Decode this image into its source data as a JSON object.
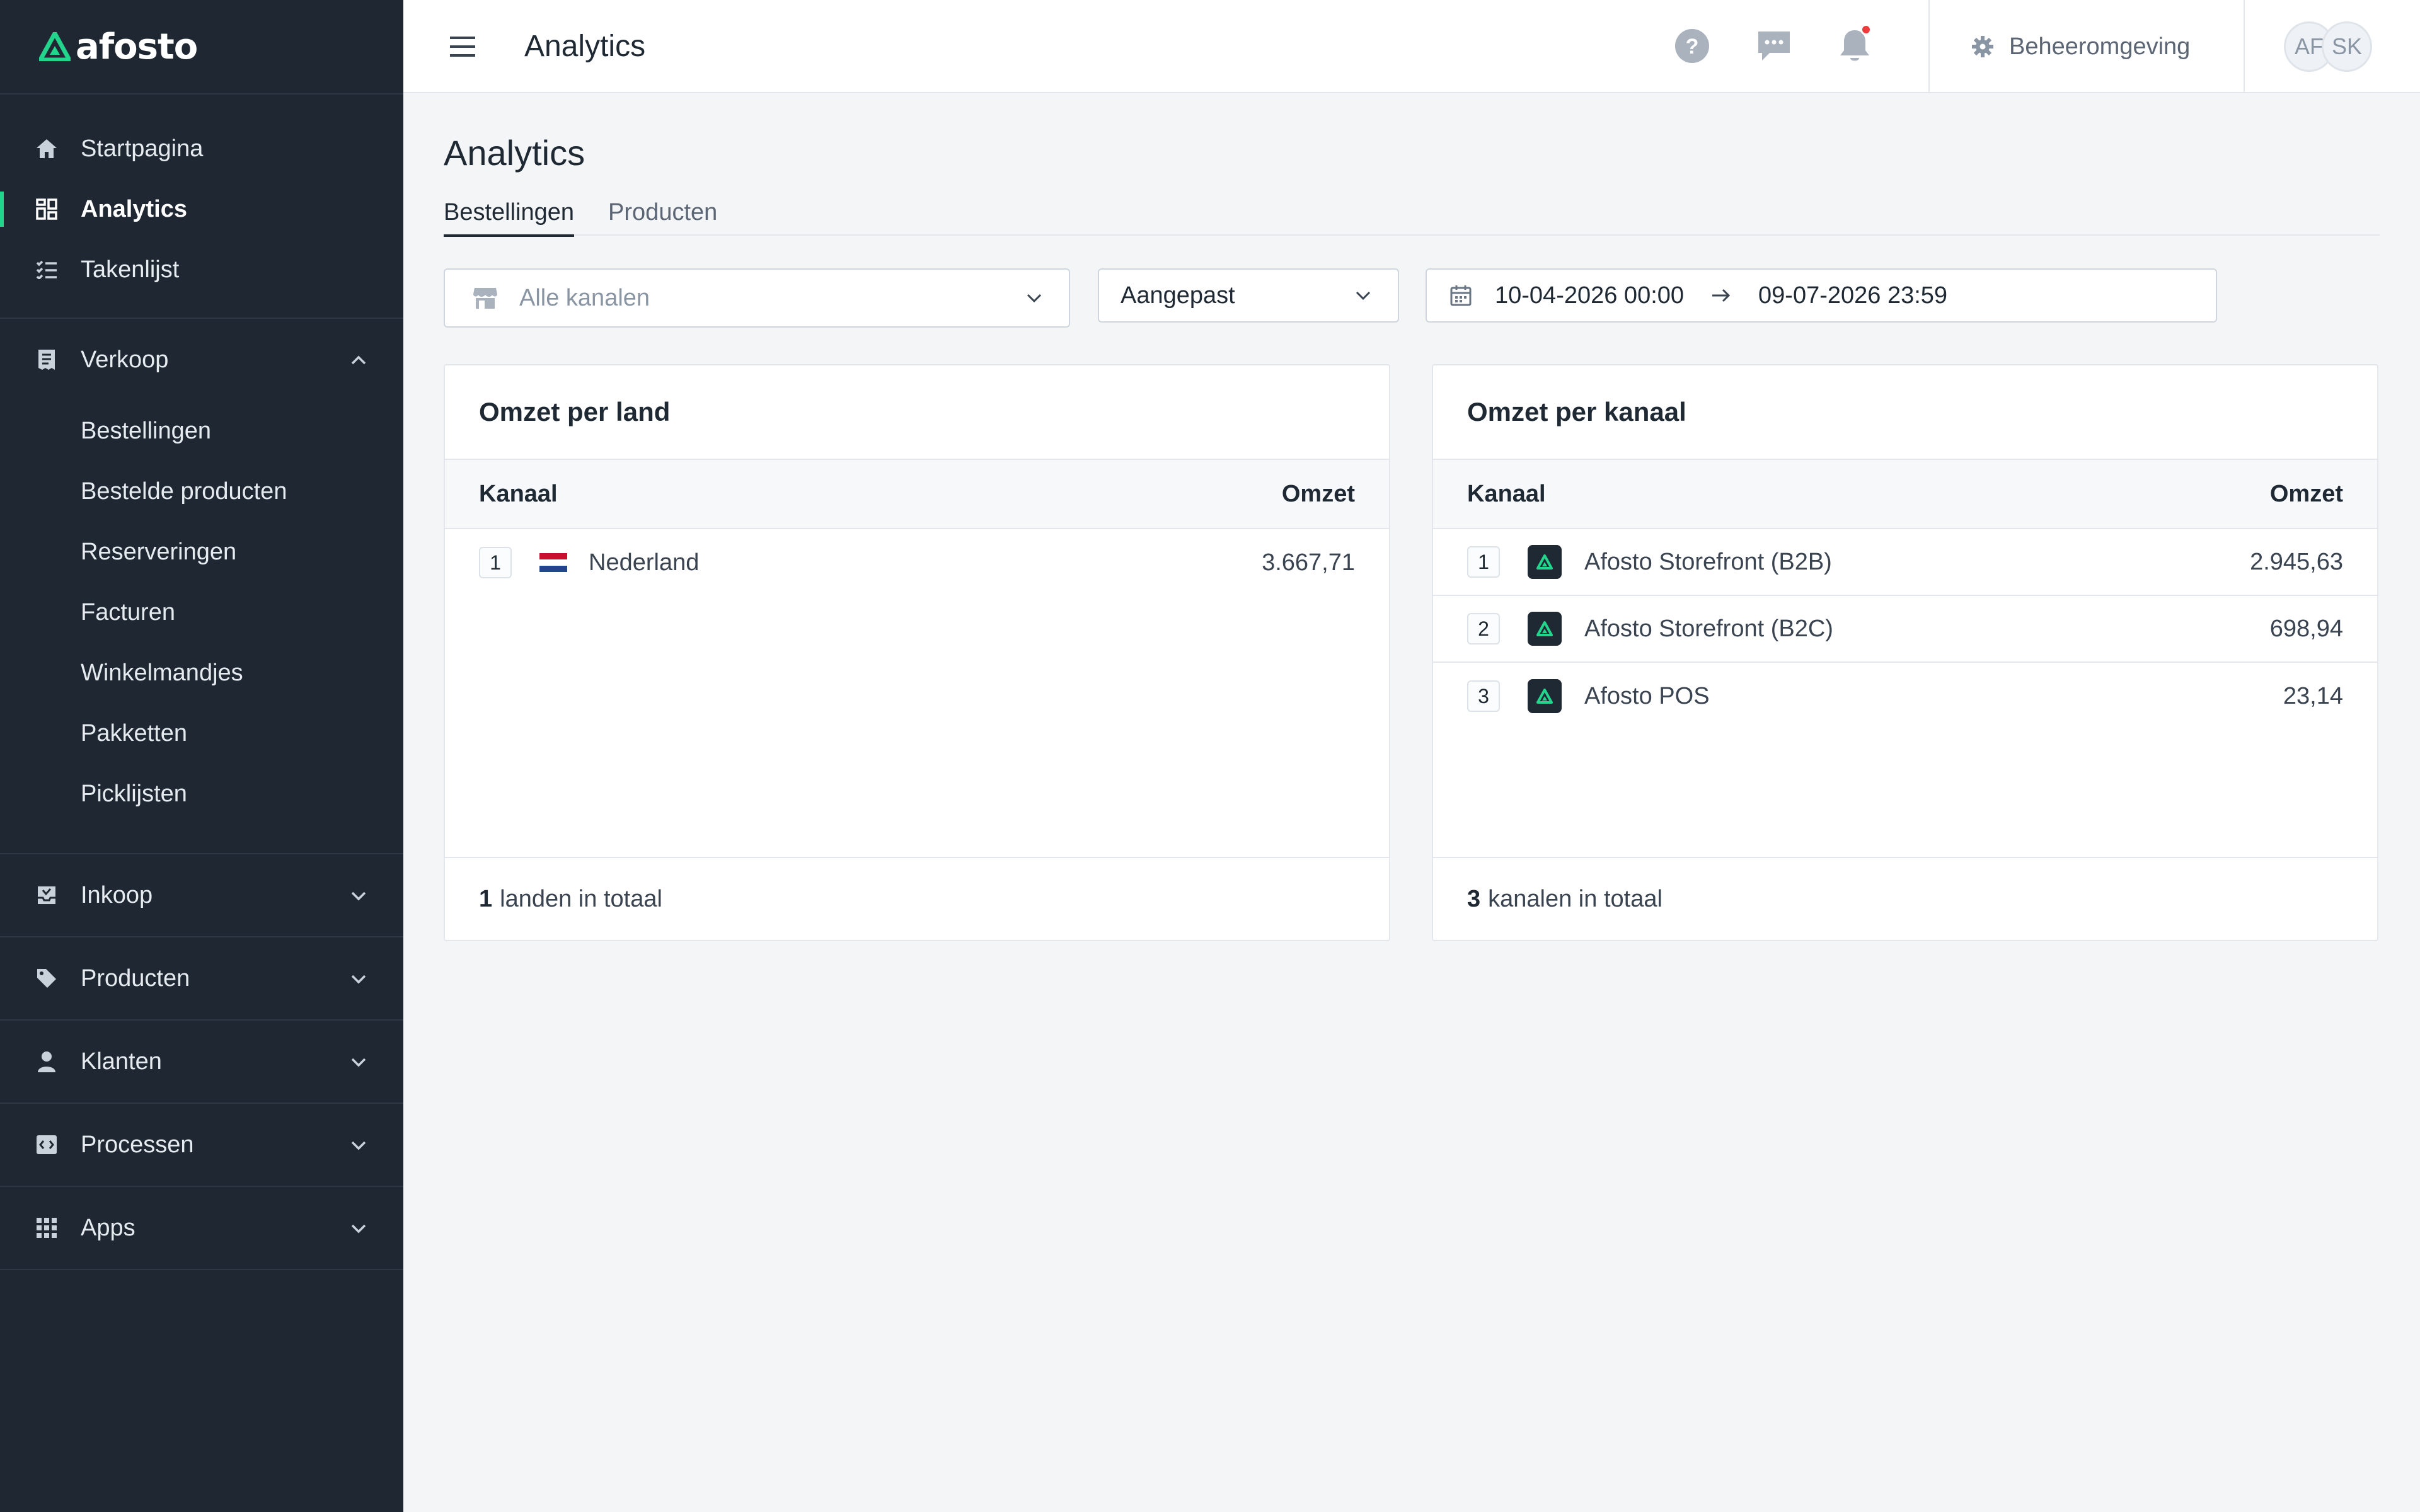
{
  "brand": {
    "name": "afosto",
    "accent": "#22d48c"
  },
  "sidebar": {
    "top_items": [
      {
        "label": "Startpagina",
        "icon": "home-icon"
      },
      {
        "label": "Analytics",
        "icon": "dashboard-icon",
        "active": true
      },
      {
        "label": "Takenlijst",
        "icon": "checklist-icon"
      }
    ],
    "sections": [
      {
        "label": "Verkoop",
        "icon": "receipt-icon",
        "expanded": true,
        "items": [
          "Bestellingen",
          "Bestelde producten",
          "Reserveringen",
          "Facturen",
          "Winkelmandjes",
          "Pakketten",
          "Picklijsten"
        ]
      },
      {
        "label": "Inkoop",
        "icon": "inbox-icon",
        "expanded": false
      },
      {
        "label": "Producten",
        "icon": "tag-icon",
        "expanded": false
      },
      {
        "label": "Klanten",
        "icon": "user-icon",
        "expanded": false
      },
      {
        "label": "Processen",
        "icon": "code-icon",
        "expanded": false
      },
      {
        "label": "Apps",
        "icon": "grid-icon",
        "expanded": false
      }
    ]
  },
  "topbar": {
    "title": "Analytics",
    "admin_label": "Beheeromgeving",
    "avatars": [
      "AF",
      "SK"
    ],
    "notification_color": "#ef3b3b"
  },
  "page": {
    "title": "Analytics",
    "tabs": [
      {
        "label": "Bestellingen",
        "active": true
      },
      {
        "label": "Producten",
        "active": false
      }
    ]
  },
  "filters": {
    "channel_placeholder": "Alle kanalen",
    "period_value": "Aangepast",
    "date_from": "10-04-2026 00:00",
    "date_to": "09-07-2026 23:59"
  },
  "cards": {
    "country": {
      "title": "Omzet per land",
      "col_left": "Kanaal",
      "col_right": "Omzet",
      "rows": [
        {
          "rank": "1",
          "name": "Nederland",
          "value": "3.667,71"
        }
      ],
      "footer_count": "1",
      "footer_text": "landen in totaal"
    },
    "channel": {
      "title": "Omzet per kanaal",
      "col_left": "Kanaal",
      "col_right": "Omzet",
      "rows": [
        {
          "rank": "1",
          "name": "Afosto Storefront (B2B)",
          "value": "2.945,63"
        },
        {
          "rank": "2",
          "name": "Afosto Storefront (B2C)",
          "value": "698,94"
        },
        {
          "rank": "3",
          "name": "Afosto POS",
          "value": "23,14"
        }
      ],
      "footer_count": "3",
      "footer_text": "kanalen in totaal"
    }
  }
}
